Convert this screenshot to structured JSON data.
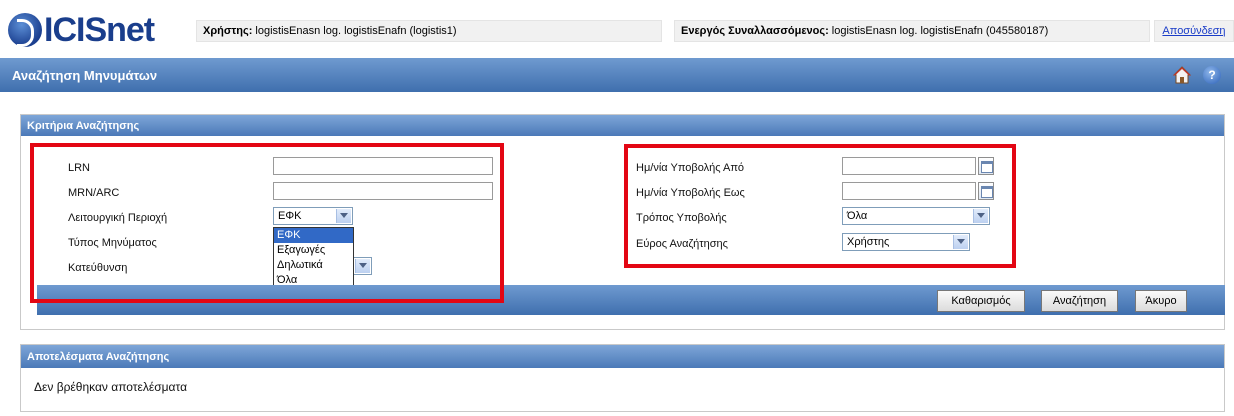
{
  "header": {
    "logo_text": "ICISnet",
    "user_label": "Χρήστης:",
    "user_value": "logistisEnasn log. logistisEnafn (logistis1)",
    "active_label": "Ενεργός Συναλλασσόμενος:",
    "active_value": "logistisEnasn log. logistisEnafn (045580187)",
    "logout": "Αποσύνδεση"
  },
  "page": {
    "title": "Αναζήτηση Μηνυμάτων",
    "help_icon_glyph": "?"
  },
  "criteria": {
    "title": "Κριτήρια Αναζήτησης",
    "left": {
      "lrn_label": "LRN",
      "mrn_label": "MRN/ARC",
      "area_label": "Λειτουργική Περιοχή",
      "area_value": "ΕΦΚ",
      "msgtype_label": "Τύπος Μηνύματος",
      "direction_label": "Κατεύθυνση",
      "area_options": [
        "ΕΦΚ",
        "Εξαγωγές",
        "Δηλωτικά",
        "Όλα"
      ]
    },
    "right": {
      "date_from_label": "Ημ/νία Υποβολής Από",
      "date_to_label": "Ημ/νία Υποβολής Εως",
      "method_label": "Τρόπος Υποβολής",
      "method_value": "Όλα",
      "scope_label": "Εύρος Αναζήτησης",
      "scope_value": "Χρήστης"
    },
    "buttons": {
      "clear": "Καθαρισμός",
      "search": "Αναζήτηση",
      "cancel": "Άκυρο"
    }
  },
  "results": {
    "title": "Αποτελέσματα Αναζήτησης",
    "empty_text": "Δεν βρέθηκαν αποτελέσματα"
  },
  "colors": {
    "header_blue": "#3f6fae",
    "highlight_red": "#e30613",
    "selected_option": "#3169c6"
  }
}
